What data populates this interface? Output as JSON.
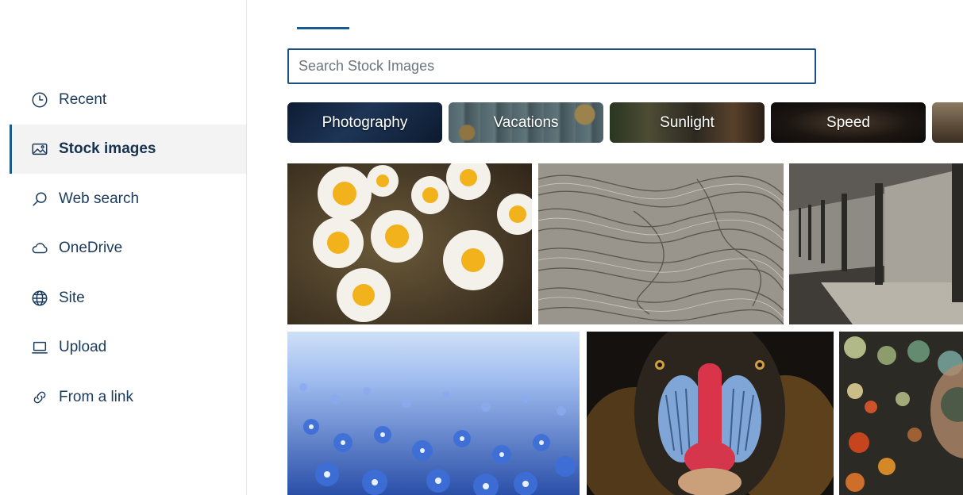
{
  "sidebar": {
    "items": [
      {
        "label": "Recent",
        "icon": "clock-icon"
      },
      {
        "label": "Stock images",
        "icon": "image-icon",
        "active": true
      },
      {
        "label": "Web search",
        "icon": "search-icon"
      },
      {
        "label": "OneDrive",
        "icon": "cloud-icon"
      },
      {
        "label": "Site",
        "icon": "globe-icon"
      },
      {
        "label": "Upload",
        "icon": "laptop-icon"
      },
      {
        "label": "From a link",
        "icon": "link-icon"
      }
    ]
  },
  "search": {
    "placeholder": "Search Stock Images"
  },
  "categories": [
    {
      "label": "Photography"
    },
    {
      "label": "Vacations"
    },
    {
      "label": "Sunlight"
    },
    {
      "label": "Speed"
    }
  ],
  "images": [
    "daisies",
    "weathered-wood",
    "concrete-corridor",
    "blue-flower-field",
    "mandrill",
    "bokeh-lights"
  ],
  "colors": {
    "accent": "#1b5a91",
    "nav_text": "#1b3a5c",
    "active_bg": "#f3f3f3"
  }
}
